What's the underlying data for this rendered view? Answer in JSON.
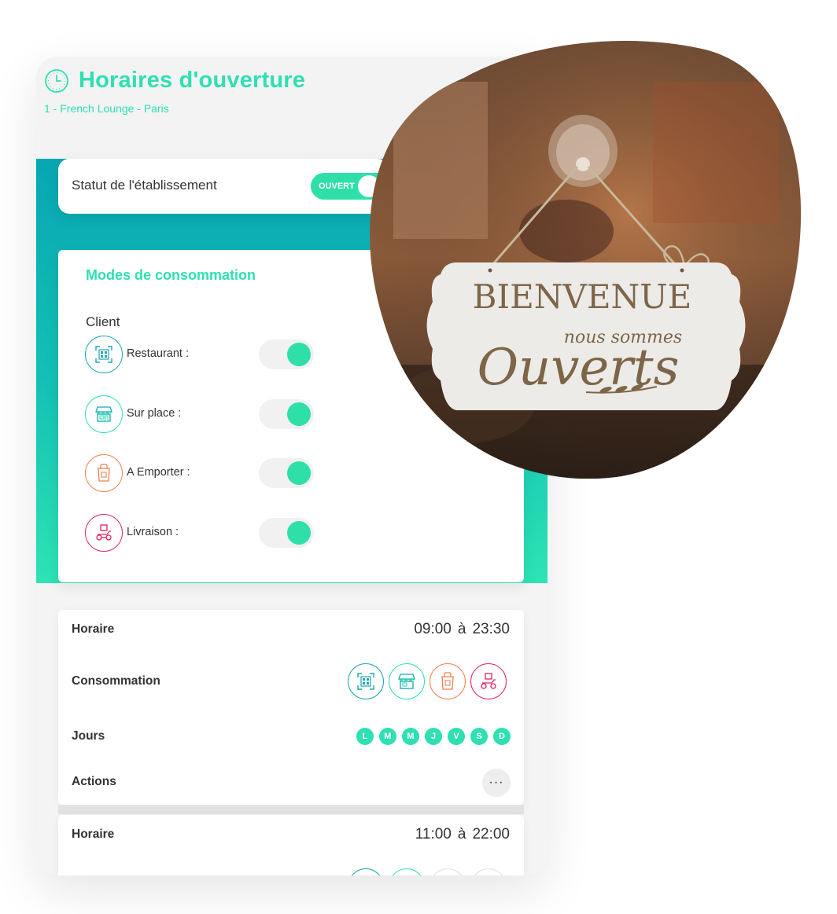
{
  "header": {
    "title": "Horaires d'ouverture",
    "subtitle": "1 - French Lounge - Paris"
  },
  "status": {
    "label": "Statut de l'établissement",
    "toggle_label": "OUVERT",
    "is_open": true
  },
  "modes": {
    "title": "Modes de consommation",
    "group_label": "Client",
    "items": [
      {
        "label": "Restaurant :",
        "icon": "restaurant-qr-icon",
        "color": "#1aa6b4",
        "enabled": true
      },
      {
        "label": "Sur place :",
        "icon": "storefront-icon",
        "color": "#2ee0b2",
        "enabled": true
      },
      {
        "label": "A Emporter :",
        "icon": "takeaway-bag-icon",
        "color": "#f08050",
        "enabled": true
      },
      {
        "label": "Livraison :",
        "icon": "delivery-scooter-icon",
        "color": "#e0245e",
        "enabled": true
      }
    ]
  },
  "schedules": [
    {
      "horaire_label": "Horaire",
      "start": "09:00",
      "sep": "à",
      "end": "23:30",
      "consommation_label": "Consommation",
      "jours_label": "Jours",
      "days": [
        "L",
        "M",
        "M",
        "J",
        "V",
        "S",
        "D"
      ],
      "actions_label": "Actions",
      "actions_icon": "···"
    },
    {
      "horaire_label": "Horaire",
      "start": "11:00",
      "sep": "à",
      "end": "22:00"
    }
  ],
  "photo": {
    "sign_line1": "BIENVENUE",
    "sign_line2": "nous sommes",
    "sign_line3": "Ouverts"
  },
  "colors": {
    "accent": "#2ee0b2",
    "teal": "#1aa6b4",
    "orange": "#f08050",
    "pink": "#e0245e",
    "toggle_on": "#2ee0a8"
  }
}
